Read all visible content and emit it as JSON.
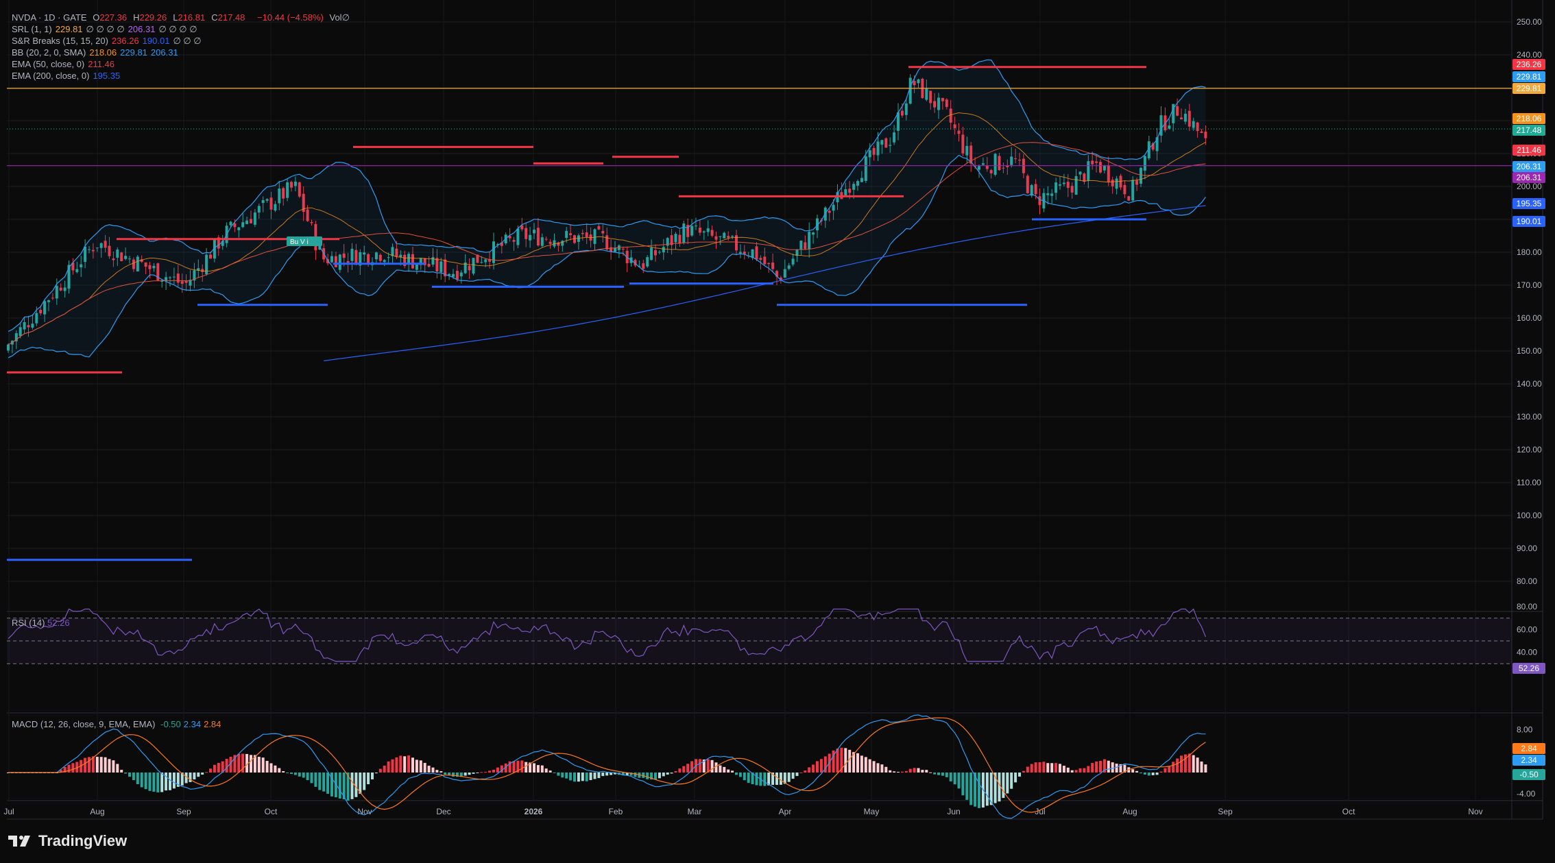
{
  "header": {
    "symbol": "NVDA · 1D · GATE",
    "ohlc": [
      {
        "k": "O",
        "v": "227.36"
      },
      {
        "k": "H",
        "v": "229.26"
      },
      {
        "k": "L",
        "v": "216.81"
      },
      {
        "k": "C",
        "v": "217.48"
      }
    ],
    "change": "−10.44 (−4.58%)",
    "vol": "Vol∅"
  },
  "indicators": [
    {
      "name": "SRL (1, 1)",
      "values": [
        {
          "v": "229.81",
          "c": "#f2a93b"
        },
        {
          "v": "∅ ∅ ∅ ∅",
          "c": "#b2b5be"
        },
        {
          "v": "206.31",
          "c": "#b667f0"
        },
        {
          "v": "∅ ∅ ∅ ∅",
          "c": "#b2b5be"
        }
      ]
    },
    {
      "name": "S&R Breaks (15, 15, 20)",
      "values": [
        {
          "v": "236.26",
          "c": "#f23645"
        },
        {
          "v": "190.01",
          "c": "#2962ff"
        },
        {
          "v": "∅ ∅ ∅",
          "c": "#b2b5be"
        }
      ]
    },
    {
      "name": "BB (20, 2, 0, SMA)",
      "values": [
        {
          "v": "218.06",
          "c": "#f7931a"
        },
        {
          "v": "229.81",
          "c": "#2f9cf3"
        },
        {
          "v": "206.31",
          "c": "#2f9cf3"
        }
      ]
    },
    {
      "name": "EMA (50, close, 0)",
      "values": [
        {
          "v": "211.46",
          "c": "#f23645"
        }
      ]
    },
    {
      "name": "EMA (200, close, 0)",
      "values": [
        {
          "v": "195.35",
          "c": "#2962ff"
        }
      ]
    }
  ],
  "axis": {
    "price_ticks": [
      "250.00",
      "240.00",
      "230.00",
      "220.00",
      "210.00",
      "200.00",
      "190.00",
      "180.00",
      "170.00",
      "160.00",
      "150.00",
      "140.00",
      "130.00",
      "120.00",
      "110.00",
      "100.00",
      "90.00",
      "80.00"
    ],
    "rsi_ticks": [
      "80.00",
      "60.00",
      "40.00"
    ],
    "macd_ticks": [
      "8.00",
      "4.00",
      "0.00",
      "-4.00"
    ],
    "time_labels": [
      "Jul",
      "Aug",
      "Sep",
      "Oct",
      "Nov",
      "Dec",
      "2026",
      "Feb",
      "Mar",
      "Apr",
      "May",
      "Jun",
      "Jul",
      "Aug",
      "Sep",
      "Oct",
      "Nov"
    ]
  },
  "price_tags": [
    {
      "v": "236.26",
      "c": "#f23645"
    },
    {
      "v": "229.81",
      "c": "#2f9cf3"
    },
    {
      "v": "229.81",
      "c": "#f2a93b"
    },
    {
      "v": "218.06",
      "c": "#f7931a"
    },
    {
      "v": "217.48",
      "c": "#22ab94"
    },
    {
      "v": "211.46",
      "c": "#f23645"
    },
    {
      "v": "206.31",
      "c": "#2f9cf3"
    },
    {
      "v": "206.31",
      "c": "#9c27b0"
    },
    {
      "v": "195.35",
      "c": "#2962ff"
    },
    {
      "v": "190.01",
      "c": "#2962ff"
    }
  ],
  "rsi": {
    "title": "RSI (14)",
    "value": "52.26",
    "color": "#7e57c2"
  },
  "macd": {
    "title": "MACD (12, 26, close, 9, EMA, EMA)",
    "values": [
      {
        "v": "-0.50",
        "c": "#26a69a"
      },
      {
        "v": "2.34",
        "c": "#2f9cf3"
      },
      {
        "v": "2.84",
        "c": "#ff7a1a"
      }
    ],
    "tags": [
      {
        "v": "2.84",
        "c": "#ff7a1a"
      },
      {
        "v": "2.34",
        "c": "#2f9cf3"
      },
      {
        "v": "-0.50",
        "c": "#26a69a"
      }
    ]
  },
  "signal_label": "Bu  V  i",
  "brand": "TradingView",
  "colors": {
    "up": "#26a69a",
    "down": "#f23645",
    "bb": "#2f9cf3",
    "ema50": "#f7931a",
    "ema200": "#2962ff",
    "resistance": "#f23645",
    "support": "#2962ff"
  }
}
